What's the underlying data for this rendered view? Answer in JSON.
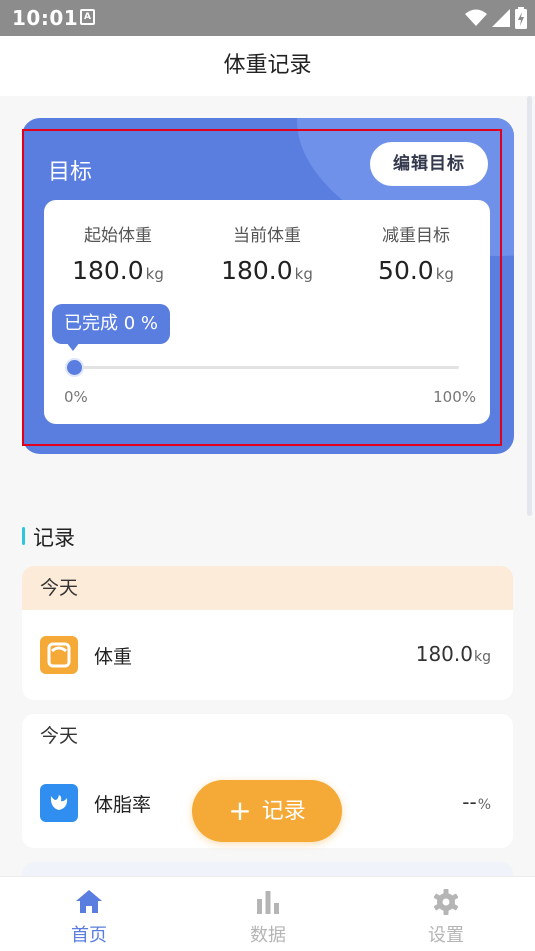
{
  "status_bar": {
    "time": "10:01",
    "notification_glyph": "A"
  },
  "header": {
    "title": "体重记录"
  },
  "goal_card": {
    "title": "目标",
    "edit_button": "编辑目标",
    "stats": [
      {
        "label": "起始体重",
        "value": "180.0",
        "unit": "kg"
      },
      {
        "label": "当前体重",
        "value": "180.0",
        "unit": "kg"
      },
      {
        "label": "减重目标",
        "value": "50.0",
        "unit": "kg"
      }
    ],
    "progress": {
      "tooltip": "已完成 0 %",
      "percent": 0,
      "min_label": "0%",
      "max_label": "100%"
    }
  },
  "records": {
    "section_title": "记录",
    "cards": [
      {
        "date": "今天",
        "name": "体重",
        "value": "180.0",
        "unit": "kg",
        "icon": "scale-icon"
      },
      {
        "date": "今天",
        "name": "体脂率",
        "value": "--",
        "unit": "%",
        "icon": "body-fat-icon"
      }
    ]
  },
  "fab": {
    "label": "记录",
    "icon": "plus-icon"
  },
  "bottom_nav": [
    {
      "label": "首页",
      "icon": "home-icon",
      "active": true
    },
    {
      "label": "数据",
      "icon": "chart-bars-icon",
      "active": false
    },
    {
      "label": "设置",
      "icon": "gear-icon",
      "active": false
    }
  ],
  "colors": {
    "primary": "#5a7ee0",
    "accent": "#f5a936",
    "today_bg": "#fcebd8",
    "section_bar": "#2fc6e0"
  }
}
